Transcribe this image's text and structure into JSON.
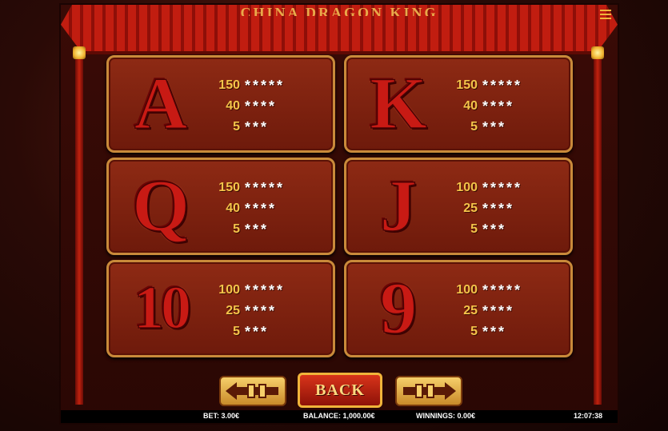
{
  "header": {
    "title": "CHINA DRAGON KING"
  },
  "paytable": [
    {
      "symbol": "A",
      "pays": [
        {
          "value": "150",
          "stars": "*****"
        },
        {
          "value": "40",
          "stars": "****"
        },
        {
          "value": "5",
          "stars": "***"
        }
      ]
    },
    {
      "symbol": "K",
      "pays": [
        {
          "value": "150",
          "stars": "*****"
        },
        {
          "value": "40",
          "stars": "****"
        },
        {
          "value": "5",
          "stars": "***"
        }
      ]
    },
    {
      "symbol": "Q",
      "pays": [
        {
          "value": "150",
          "stars": "*****"
        },
        {
          "value": "40",
          "stars": "****"
        },
        {
          "value": "5",
          "stars": "***"
        }
      ]
    },
    {
      "symbol": "J",
      "pays": [
        {
          "value": "100",
          "stars": "*****"
        },
        {
          "value": "25",
          "stars": "****"
        },
        {
          "value": "5",
          "stars": "***"
        }
      ]
    },
    {
      "symbol": "10",
      "pays": [
        {
          "value": "100",
          "stars": "*****"
        },
        {
          "value": "25",
          "stars": "****"
        },
        {
          "value": "5",
          "stars": "***"
        }
      ]
    },
    {
      "symbol": "9",
      "pays": [
        {
          "value": "100",
          "stars": "*****"
        },
        {
          "value": "25",
          "stars": "****"
        },
        {
          "value": "5",
          "stars": "***"
        }
      ]
    }
  ],
  "controls": {
    "back_label": "BACK"
  },
  "status": {
    "bet": "BET: 3.00€",
    "balance": "BALANCE: 1,000.00€",
    "winnings": "WINNINGS: 0.00€",
    "clock": "12:07:38"
  },
  "icons": {
    "menu": "hamburger-menu-icon",
    "prev": "arrow-left-icon",
    "next": "arrow-right-icon"
  },
  "colors": {
    "accent": "#f4c44a",
    "panel": "#7a2210",
    "symbol": "#c81a14"
  }
}
